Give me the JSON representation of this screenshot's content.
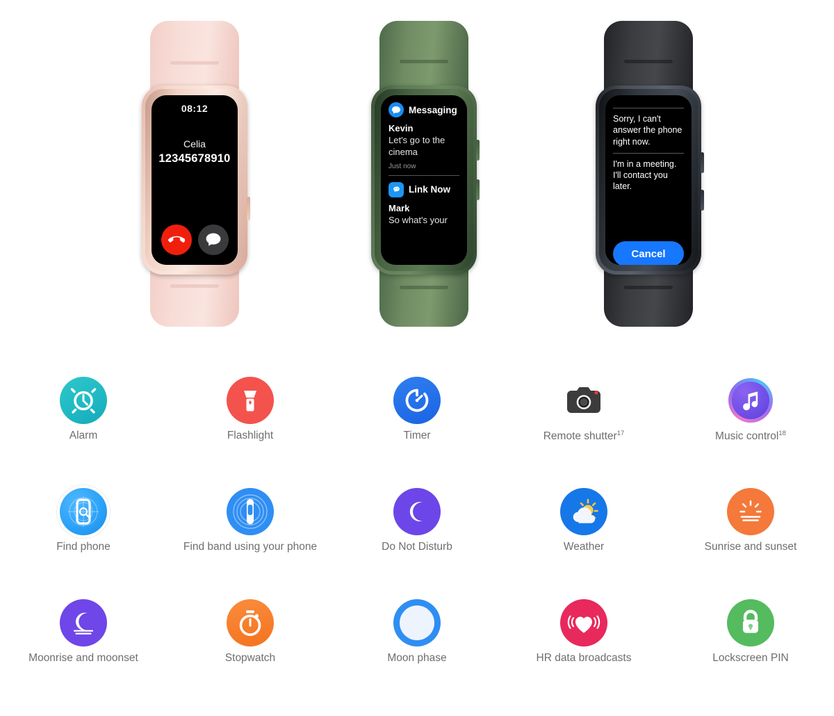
{
  "watches": [
    {
      "id": "watch-incoming-call",
      "band_color": "#f6ddd7",
      "screen": {
        "type": "incoming-call",
        "time": "08:12",
        "caller_name": "Celia",
        "caller_number": "12345678910",
        "decline_icon": "phone-decline-icon",
        "message_icon": "message-bubble-icon"
      }
    },
    {
      "id": "watch-notifications",
      "band_color": "#6f8c63",
      "screen": {
        "type": "notification-list",
        "notifications": [
          {
            "app": "Messaging",
            "app_icon": "messaging-app-icon",
            "sender": "Kevin",
            "body": "Let's go to the cinema",
            "time": "Just now"
          },
          {
            "app": "Link Now",
            "app_icon": "link-now-app-icon",
            "sender": "Mark",
            "body": "So what's your",
            "time": ""
          }
        ]
      }
    },
    {
      "id": "watch-quick-replies",
      "band_color": "#3a3c40",
      "screen": {
        "type": "quick-reply",
        "replies": [
          "Sorry, I can't answer the phone right now.",
          "I'm in a meeting. I'll contact you later."
        ],
        "cancel_label": "Cancel",
        "cancel_color": "#1677ff"
      }
    }
  ],
  "features": {
    "rows": [
      [
        {
          "label": "Alarm",
          "sup": "",
          "icon": "alarm-clock-icon",
          "color": "#1fb9c4"
        },
        {
          "label": "Flashlight",
          "sup": "",
          "icon": "flashlight-icon",
          "color": "#f4524d"
        },
        {
          "label": "Timer",
          "sup": "",
          "icon": "timer-icon",
          "color": "#1b63e3"
        },
        {
          "label": "Remote shutter",
          "sup": "17",
          "icon": "camera-shutter-icon",
          "color": "#3c3c3c"
        },
        {
          "label": "Music control",
          "sup": "18",
          "icon": "music-note-icon",
          "color": "#6b4fe8"
        }
      ],
      [
        {
          "label": "Find phone",
          "sup": "",
          "icon": "find-phone-icon",
          "color": "#29a0f7"
        },
        {
          "label": "Find band using your phone",
          "sup": "",
          "icon": "find-band-icon",
          "color": "#2f8ef4"
        },
        {
          "label": "Do Not Disturb",
          "sup": "",
          "icon": "do-not-disturb-icon",
          "color": "#6c46e8"
        },
        {
          "label": "Weather",
          "sup": "",
          "icon": "weather-icon",
          "color": "#1677e8"
        },
        {
          "label": "Sunrise and sunset",
          "sup": "",
          "icon": "sunrise-sunset-icon",
          "color": "#f4793a"
        }
      ],
      [
        {
          "label": "Moonrise and moonset",
          "sup": "",
          "icon": "moonrise-moonset-icon",
          "color": "#6f46e8"
        },
        {
          "label": "Stopwatch",
          "sup": "",
          "icon": "stopwatch-icon",
          "color": "#f4731f"
        },
        {
          "label": "Moon phase",
          "sup": "",
          "icon": "moon-phase-icon",
          "color": "#2f8ef4"
        },
        {
          "label": "HR data broadcasts",
          "sup": "",
          "icon": "heart-rate-icon",
          "color": "#e8295c"
        },
        {
          "label": "Lockscreen PIN",
          "sup": "",
          "icon": "lock-icon",
          "color": "#55bb5f"
        }
      ]
    ]
  }
}
